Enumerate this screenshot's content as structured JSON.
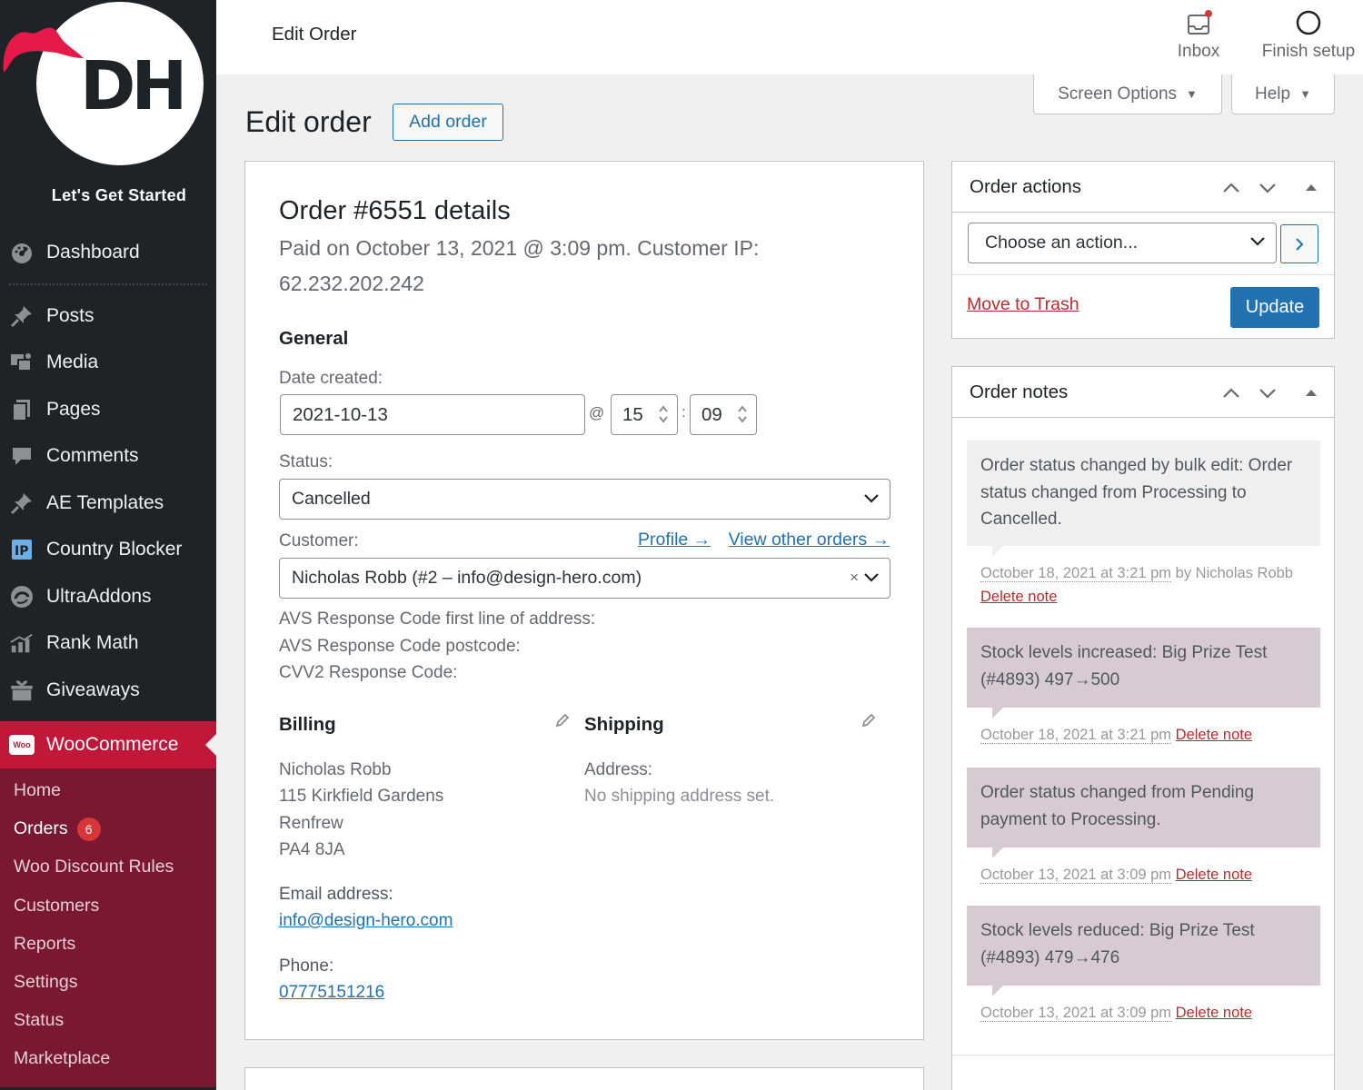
{
  "colors": {
    "sidebar_bg": "#1d2327",
    "woo_active": "#c1183a",
    "woo_submenu": "#791830",
    "accent": "#2271b1",
    "danger": "#b32d2e",
    "badge": "#d63638"
  },
  "brand": {
    "logo_letters": "DH",
    "tagline": "Let's Get Started"
  },
  "sidebar": {
    "items": [
      {
        "label": "Dashboard",
        "icon": "dashboard-icon"
      },
      {
        "label": "Posts",
        "icon": "pin-icon"
      },
      {
        "label": "Media",
        "icon": "media-icon"
      },
      {
        "label": "Pages",
        "icon": "pages-icon"
      },
      {
        "label": "Comments",
        "icon": "comment-icon"
      },
      {
        "label": "AE Templates",
        "icon": "pin-icon"
      },
      {
        "label": "Country Blocker",
        "icon": "ip-icon"
      },
      {
        "label": "UltraAddons",
        "icon": "ultraaddons-icon"
      },
      {
        "label": "Rank Math",
        "icon": "chart-icon"
      },
      {
        "label": "Giveaways",
        "icon": "giveaways-icon"
      }
    ],
    "woocommerce": {
      "label": "WooCommerce",
      "icon_text": "Woo"
    },
    "submenu": [
      {
        "label": "Home"
      },
      {
        "label": "Orders",
        "badge": "6"
      },
      {
        "label": "Woo Discount Rules"
      },
      {
        "label": "Customers"
      },
      {
        "label": "Reports"
      },
      {
        "label": "Settings"
      },
      {
        "label": "Status"
      },
      {
        "label": "Marketplace"
      }
    ]
  },
  "topbar": {
    "title": "Edit Order",
    "inbox": "Inbox",
    "finish": "Finish setup"
  },
  "screen_options": {
    "screen": "Screen Options",
    "help": "Help"
  },
  "heading": {
    "title": "Edit order",
    "add_order": "Add order"
  },
  "order": {
    "title": "Order #6551 details",
    "subtitle": "Paid on October 13, 2021 @ 3:09 pm. Customer IP: 62.232.202.242",
    "general_heading": "General",
    "date_label": "Date created:",
    "date_value": "2021-10-13",
    "at_sign": "@",
    "colon": ":",
    "hour": "15",
    "minute": "09",
    "status_label": "Status:",
    "status_value": "Cancelled",
    "customer_label": "Customer:",
    "profile_link": "Profile →",
    "other_orders_link": "View other orders →",
    "customer_value": "Nicholas Robb (#2 – info@design-hero.com)",
    "clear_mark": "×",
    "avs_address": "AVS Response Code first line of address:",
    "avs_postcode": "AVS Response Code postcode:",
    "cvv2": "CVV2 Response Code:",
    "billing": {
      "heading": "Billing",
      "lines": [
        "Nicholas Robb",
        "115 Kirkfield Gardens",
        "Renfrew",
        "PA4 8JA"
      ],
      "email_label": "Email address:",
      "email": "info@design-hero.com",
      "phone_label": "Phone:",
      "phone": "07775151216"
    },
    "shipping": {
      "heading": "Shipping",
      "address_label": "Address:",
      "address_value": "No shipping address set."
    }
  },
  "order_actions": {
    "title": "Order actions",
    "select_placeholder": "Choose an action...",
    "trash": "Move to Trash",
    "update": "Update"
  },
  "order_notes": {
    "title": "Order notes",
    "delete_label": "Delete note",
    "notes": [
      {
        "text": "Order status changed by bulk edit: Order status changed from Processing to Cancelled.",
        "timestamp": "October 18, 2021 at 3:21 pm",
        "by": "by Nicholas Robb",
        "type": "system"
      },
      {
        "text": "Stock levels increased: Big Prize Test (#4893) 497→500",
        "timestamp": "October 18, 2021 at 3:21 pm",
        "by": "",
        "type": "customer"
      },
      {
        "text": "Order status changed from Pending payment to Processing.",
        "timestamp": "October 13, 2021 at 3:09 pm",
        "by": "",
        "type": "customer"
      },
      {
        "text": "Stock levels reduced: Big Prize Test (#4893) 479→476",
        "timestamp": "October 13, 2021 at 3:09 pm",
        "by": "",
        "type": "customer"
      }
    ]
  }
}
